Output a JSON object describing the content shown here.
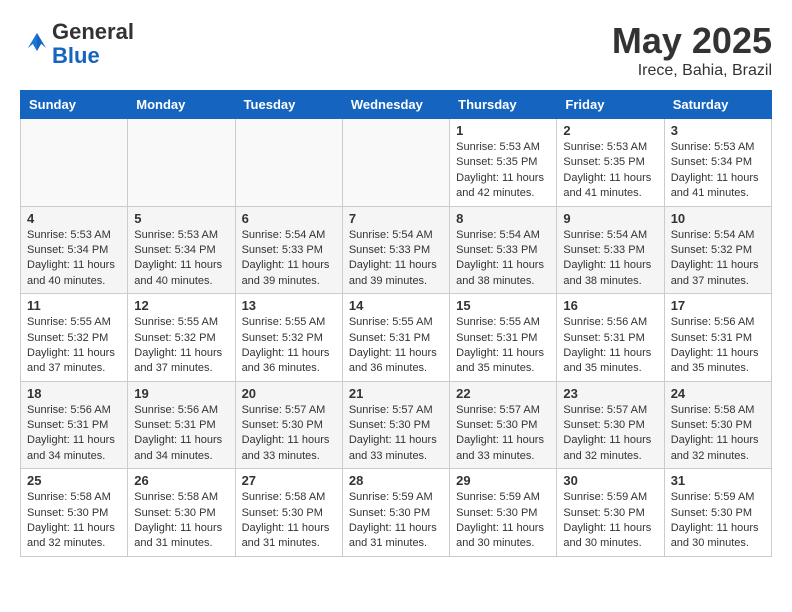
{
  "header": {
    "logo_general": "General",
    "logo_blue": "Blue",
    "title": "May 2025",
    "subtitle": "Irece, Bahia, Brazil"
  },
  "days_of_week": [
    "Sunday",
    "Monday",
    "Tuesday",
    "Wednesday",
    "Thursday",
    "Friday",
    "Saturday"
  ],
  "weeks": [
    [
      {
        "day": "",
        "info": ""
      },
      {
        "day": "",
        "info": ""
      },
      {
        "day": "",
        "info": ""
      },
      {
        "day": "",
        "info": ""
      },
      {
        "day": "1",
        "info": "Sunrise: 5:53 AM\nSunset: 5:35 PM\nDaylight: 11 hours and 42 minutes."
      },
      {
        "day": "2",
        "info": "Sunrise: 5:53 AM\nSunset: 5:35 PM\nDaylight: 11 hours and 41 minutes."
      },
      {
        "day": "3",
        "info": "Sunrise: 5:53 AM\nSunset: 5:34 PM\nDaylight: 11 hours and 41 minutes."
      }
    ],
    [
      {
        "day": "4",
        "info": "Sunrise: 5:53 AM\nSunset: 5:34 PM\nDaylight: 11 hours and 40 minutes."
      },
      {
        "day": "5",
        "info": "Sunrise: 5:53 AM\nSunset: 5:34 PM\nDaylight: 11 hours and 40 minutes."
      },
      {
        "day": "6",
        "info": "Sunrise: 5:54 AM\nSunset: 5:33 PM\nDaylight: 11 hours and 39 minutes."
      },
      {
        "day": "7",
        "info": "Sunrise: 5:54 AM\nSunset: 5:33 PM\nDaylight: 11 hours and 39 minutes."
      },
      {
        "day": "8",
        "info": "Sunrise: 5:54 AM\nSunset: 5:33 PM\nDaylight: 11 hours and 38 minutes."
      },
      {
        "day": "9",
        "info": "Sunrise: 5:54 AM\nSunset: 5:33 PM\nDaylight: 11 hours and 38 minutes."
      },
      {
        "day": "10",
        "info": "Sunrise: 5:54 AM\nSunset: 5:32 PM\nDaylight: 11 hours and 37 minutes."
      }
    ],
    [
      {
        "day": "11",
        "info": "Sunrise: 5:55 AM\nSunset: 5:32 PM\nDaylight: 11 hours and 37 minutes."
      },
      {
        "day": "12",
        "info": "Sunrise: 5:55 AM\nSunset: 5:32 PM\nDaylight: 11 hours and 37 minutes."
      },
      {
        "day": "13",
        "info": "Sunrise: 5:55 AM\nSunset: 5:32 PM\nDaylight: 11 hours and 36 minutes."
      },
      {
        "day": "14",
        "info": "Sunrise: 5:55 AM\nSunset: 5:31 PM\nDaylight: 11 hours and 36 minutes."
      },
      {
        "day": "15",
        "info": "Sunrise: 5:55 AM\nSunset: 5:31 PM\nDaylight: 11 hours and 35 minutes."
      },
      {
        "day": "16",
        "info": "Sunrise: 5:56 AM\nSunset: 5:31 PM\nDaylight: 11 hours and 35 minutes."
      },
      {
        "day": "17",
        "info": "Sunrise: 5:56 AM\nSunset: 5:31 PM\nDaylight: 11 hours and 35 minutes."
      }
    ],
    [
      {
        "day": "18",
        "info": "Sunrise: 5:56 AM\nSunset: 5:31 PM\nDaylight: 11 hours and 34 minutes."
      },
      {
        "day": "19",
        "info": "Sunrise: 5:56 AM\nSunset: 5:31 PM\nDaylight: 11 hours and 34 minutes."
      },
      {
        "day": "20",
        "info": "Sunrise: 5:57 AM\nSunset: 5:30 PM\nDaylight: 11 hours and 33 minutes."
      },
      {
        "day": "21",
        "info": "Sunrise: 5:57 AM\nSunset: 5:30 PM\nDaylight: 11 hours and 33 minutes."
      },
      {
        "day": "22",
        "info": "Sunrise: 5:57 AM\nSunset: 5:30 PM\nDaylight: 11 hours and 33 minutes."
      },
      {
        "day": "23",
        "info": "Sunrise: 5:57 AM\nSunset: 5:30 PM\nDaylight: 11 hours and 32 minutes."
      },
      {
        "day": "24",
        "info": "Sunrise: 5:58 AM\nSunset: 5:30 PM\nDaylight: 11 hours and 32 minutes."
      }
    ],
    [
      {
        "day": "25",
        "info": "Sunrise: 5:58 AM\nSunset: 5:30 PM\nDaylight: 11 hours and 32 minutes."
      },
      {
        "day": "26",
        "info": "Sunrise: 5:58 AM\nSunset: 5:30 PM\nDaylight: 11 hours and 31 minutes."
      },
      {
        "day": "27",
        "info": "Sunrise: 5:58 AM\nSunset: 5:30 PM\nDaylight: 11 hours and 31 minutes."
      },
      {
        "day": "28",
        "info": "Sunrise: 5:59 AM\nSunset: 5:30 PM\nDaylight: 11 hours and 31 minutes."
      },
      {
        "day": "29",
        "info": "Sunrise: 5:59 AM\nSunset: 5:30 PM\nDaylight: 11 hours and 30 minutes."
      },
      {
        "day": "30",
        "info": "Sunrise: 5:59 AM\nSunset: 5:30 PM\nDaylight: 11 hours and 30 minutes."
      },
      {
        "day": "31",
        "info": "Sunrise: 5:59 AM\nSunset: 5:30 PM\nDaylight: 11 hours and 30 minutes."
      }
    ]
  ]
}
